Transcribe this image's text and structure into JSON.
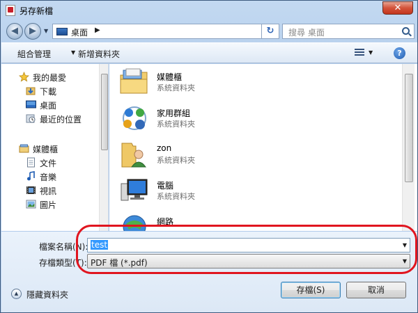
{
  "window": {
    "title": "另存新檔",
    "close_label": "✕"
  },
  "nav": {
    "back": "◀",
    "forward": "▶",
    "refresh": "↻"
  },
  "address": {
    "location": "桌面",
    "chevron": "▶"
  },
  "search": {
    "placeholder": "搜尋 桌面"
  },
  "toolbar": {
    "organize": "組合管理",
    "new_folder": "新增資料夾",
    "help": "?"
  },
  "sidebar": {
    "items": [
      {
        "label": "我的最愛",
        "icon": "star-icon"
      },
      {
        "label": "下載",
        "icon": "download-icon"
      },
      {
        "label": "桌面",
        "icon": "desktop-icon"
      },
      {
        "label": "最近的位置",
        "icon": "recent-places-icon"
      },
      {
        "label": "媒體櫃",
        "icon": "library-icon"
      },
      {
        "label": "文件",
        "icon": "document-icon"
      },
      {
        "label": "音樂",
        "icon": "music-icon"
      },
      {
        "label": "視訊",
        "icon": "video-icon"
      },
      {
        "label": "圖片",
        "icon": "picture-icon"
      }
    ]
  },
  "files": [
    {
      "name": "媒體櫃",
      "type": "系統資料夾",
      "icon": "library-folder-icon"
    },
    {
      "name": "家用群組",
      "type": "系統資料夾",
      "icon": "homegroup-icon"
    },
    {
      "name": "zon",
      "type": "系統資料夾",
      "icon": "user-folder-icon"
    },
    {
      "name": "電腦",
      "type": "系統資料夾",
      "icon": "computer-icon"
    },
    {
      "name": "網路",
      "type": "",
      "icon": "network-icon"
    }
  ],
  "form": {
    "filename_label": "檔案名稱(N):",
    "filename_value": "test",
    "filetype_label": "存檔類型(T):",
    "filetype_value": "PDF 檔 (*.pdf)"
  },
  "footer": {
    "hide_folders": "隱藏資料夾",
    "save": "存檔(S)",
    "cancel": "取消"
  },
  "colors": {
    "annotation": "#e0151f",
    "selection": "#3399ff"
  }
}
